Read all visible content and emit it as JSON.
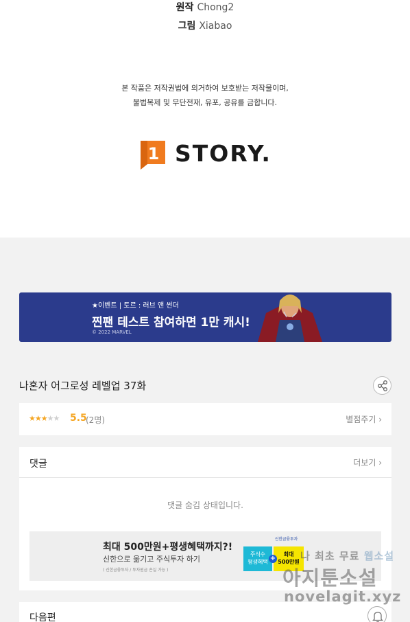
{
  "credits": {
    "original_key": "원작",
    "original_value": "Chong2",
    "art_key": "그림",
    "art_value": "Xiabao"
  },
  "copyright": {
    "line1": "본 작품은 저작권법에 의거하여 보호받는 저작물이며,",
    "line2": "불법복제 및 무단전재, 유포, 공유를 금합니다."
  },
  "logo": {
    "mark": "1",
    "text": "STORY."
  },
  "banner": {
    "small": "★이벤트 | 토르 : 러브 앤 썬더",
    "big": "찐팬 테스트 참여하면 1만 캐시!",
    "tiny": "© 2022 MARVEL"
  },
  "episode": {
    "title": "나혼자 어그로성 레벨업 37화"
  },
  "rating": {
    "stars_on": "★★★",
    "stars_off": "★★",
    "score": "5.5",
    "count": "(2명)",
    "rate_link": "별점주기 ›"
  },
  "comments": {
    "header": "댓글",
    "more": "더보기 ›",
    "hidden_message": "댓글 숨김 상태입니다."
  },
  "ad": {
    "line1": "최대 500만원+평생혜택까지?!",
    "line2": "신한으로 옮기고 주식투자 하기",
    "line3": "( 신한금융투자 / 투자원금 손실 가능 )",
    "bank": "신한금융투자",
    "box1_top": "주식수",
    "box1_bottom": "평생혜택",
    "box2_top": "최대",
    "box2_bottom": "500만원",
    "plus": "+"
  },
  "next": {
    "label": "다음편"
  },
  "watermark": {
    "line1_a": "나 최초 무료",
    "line1_b": "웹소설",
    "line2": "아지툰소설",
    "line3": "novelagit.xyz"
  },
  "colors": {
    "star_on": "#f5a623",
    "star_off": "#cfcfcf",
    "banner_bg": "#2b3b8c",
    "logo_orange": "#f07b1f",
    "page_bg": "#f2f2f2"
  },
  "icons": {
    "share": "share-icon",
    "bell": "bell-icon",
    "chevron": "chevron-right-icon"
  }
}
